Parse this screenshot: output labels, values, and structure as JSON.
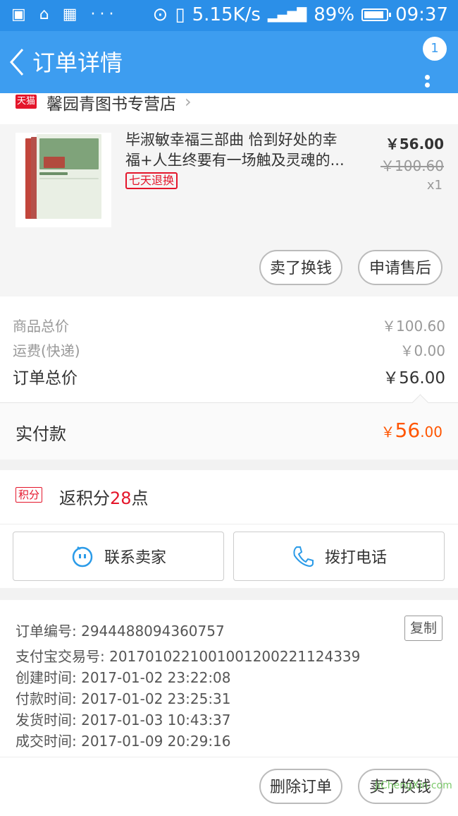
{
  "status_bar": {
    "net_speed": "5.15K/s",
    "battery": "89%",
    "battery_level": 0.89,
    "time": "09:37"
  },
  "nav": {
    "title": "订单详情",
    "badge": "1"
  },
  "shop": {
    "platform_badge": "天猫",
    "name": "馨园青图书专营店"
  },
  "product": {
    "title": "毕淑敏幸福三部曲 恰到好处的幸福+人生终要有一场触及灵魂的...",
    "tag": "七天退换",
    "price": "￥56.00",
    "original_price": "￥100.60",
    "quantity": "x1",
    "actions": [
      "卖了换钱",
      "申请售后"
    ]
  },
  "summary": {
    "goods_total_label": "商品总价",
    "goods_total": "￥100.60",
    "shipping_label": "运费(快递)",
    "shipping": "￥0.00",
    "order_total_label": "订单总价",
    "order_total": "￥56.00",
    "paid_label": "实付款",
    "paid_symbol": "￥",
    "paid_int": "56",
    "paid_dec": ".00"
  },
  "points": {
    "tag": "积分",
    "prefix": "返积分",
    "value": "28",
    "suffix": "点"
  },
  "contact": {
    "seller_label": "联系卖家",
    "call_label": "拨打电话"
  },
  "order_info": {
    "order_no": "订单编号: 2944488094360757",
    "copy_label": "复制",
    "alipay_no": "支付宝交易号: 2017010221001001200221124339",
    "created": "创建时间: 2017-01-02 23:22:08",
    "paid": "付款时间: 2017-01-02 23:25:31",
    "shipped": "发货时间: 2017-01-03 10:43:37",
    "completed": "成交时间: 2017-01-09 20:29:16"
  },
  "bottom": {
    "delete_label": "删除订单",
    "sell_label": "卖了换钱"
  },
  "watermark": {
    "text": "JiChengXin.com"
  },
  "colors": {
    "status_bar": "#2b8fe8",
    "nav_bar": "#3d9df0",
    "tmall_red": "#e4162b",
    "paid_orange": "#ff5500"
  }
}
